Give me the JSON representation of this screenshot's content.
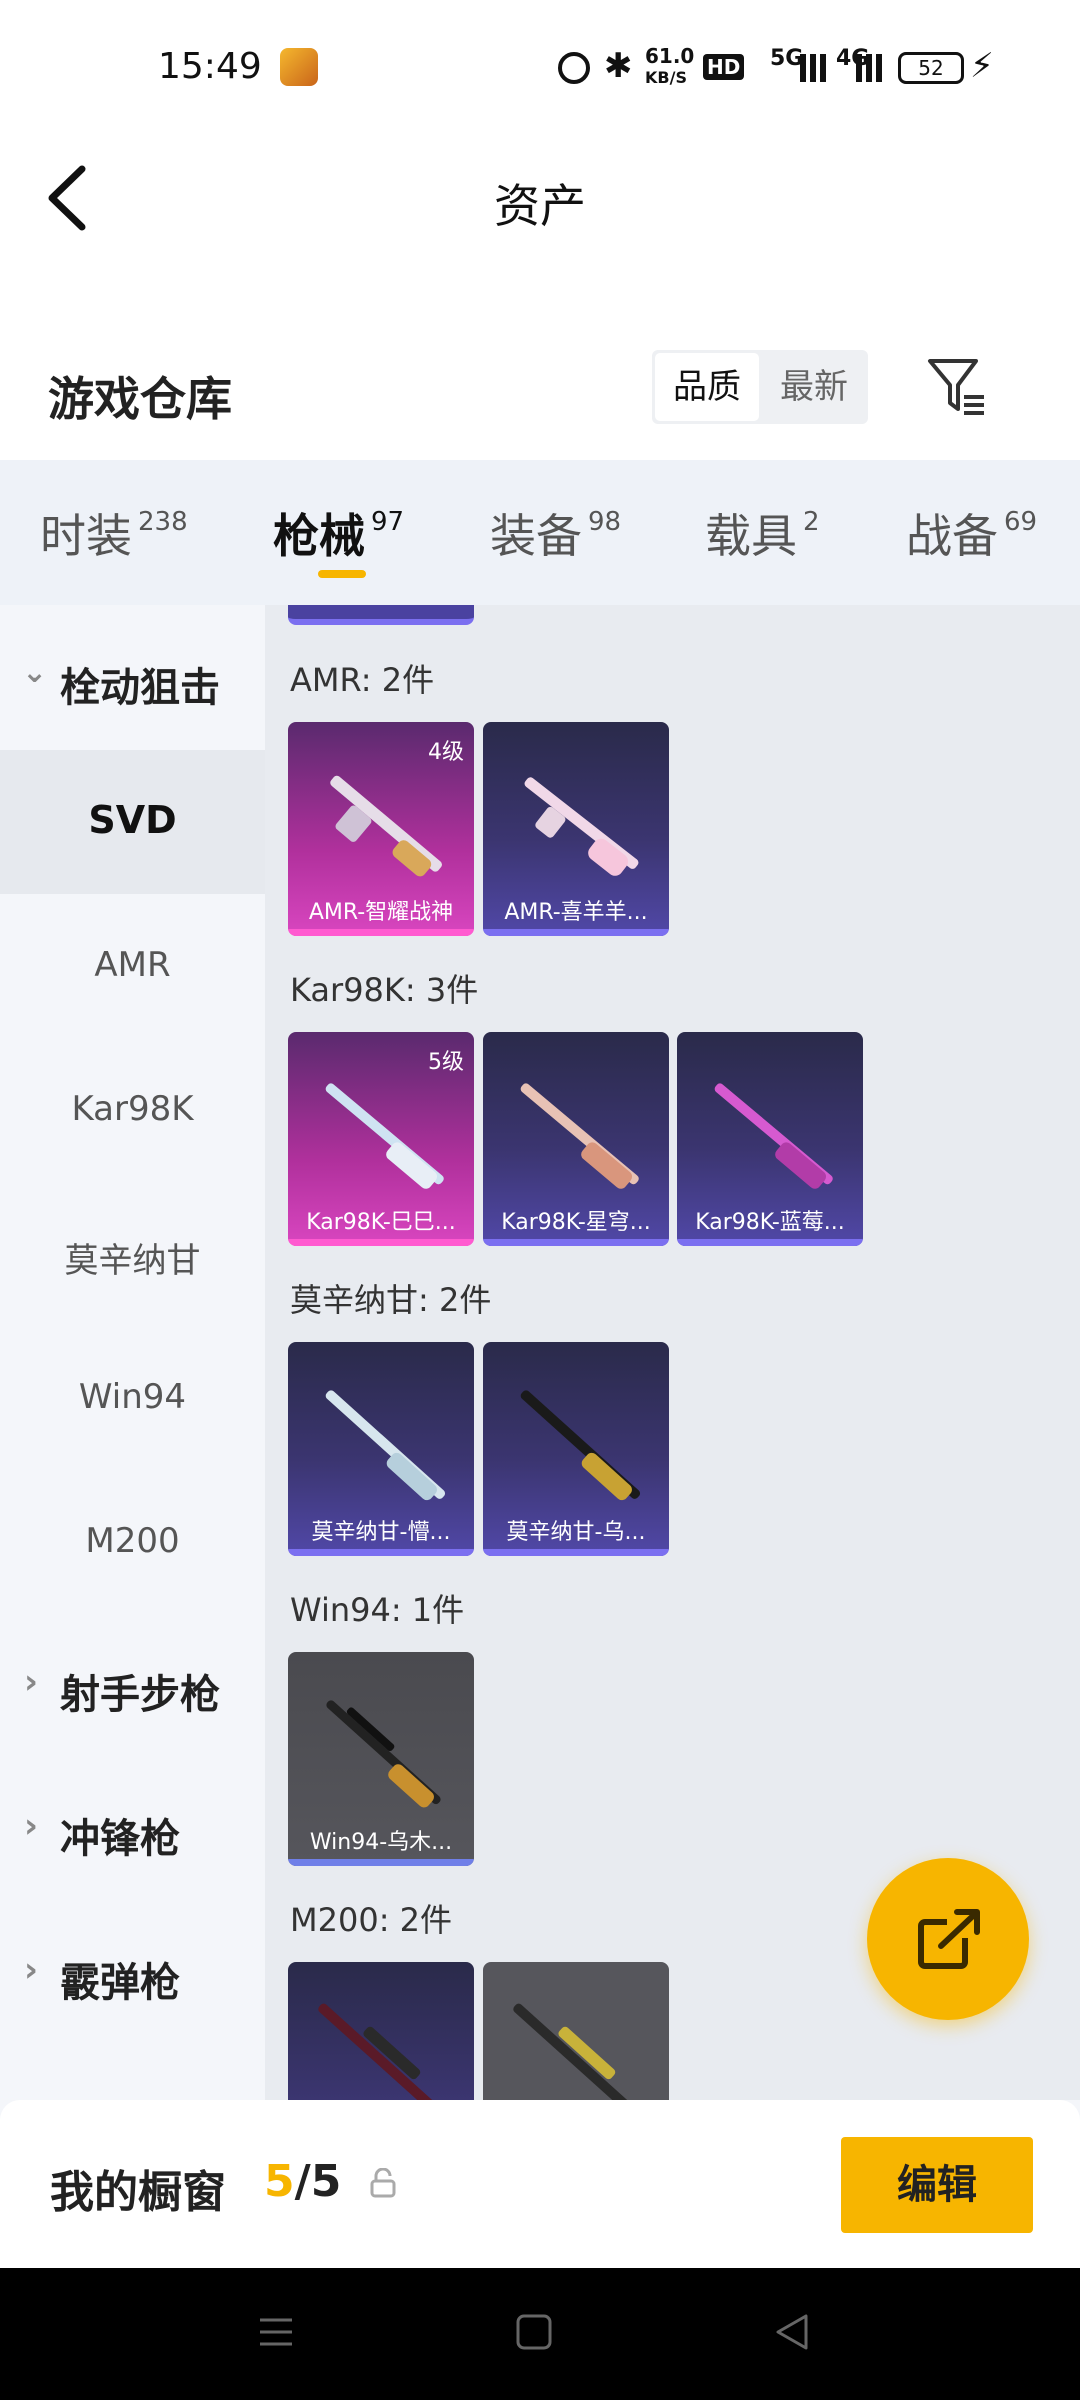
{
  "status": {
    "time": "15:49",
    "net_speed": "61.0",
    "net_unit": "KB/S",
    "hd": "HD",
    "sig1": "5G",
    "sig2": "4G",
    "battery": "52"
  },
  "header": {
    "title": "资产"
  },
  "warehouse": {
    "title": "游戏仓库",
    "sort_quality": "品质",
    "sort_latest": "最新"
  },
  "tabs": [
    {
      "label": "时装",
      "count": "238"
    },
    {
      "label": "枪械",
      "count": "97"
    },
    {
      "label": "装备",
      "count": "98"
    },
    {
      "label": "载具",
      "count": "2"
    },
    {
      "label": "战备",
      "count": "69"
    }
  ],
  "sidebar": {
    "group_open": "栓动狙击",
    "items": [
      "SVD",
      "AMR",
      "Kar98K",
      "莫辛纳甘",
      "Win94",
      "M200"
    ],
    "groups": [
      "射手步枪",
      "冲锋枪",
      "霰弹枪"
    ]
  },
  "groups": [
    {
      "title": "AMR: 2件",
      "cards": [
        {
          "name": "AMR-智耀战神",
          "level": "4级",
          "style": "pink"
        },
        {
          "name": "AMR-喜羊羊...",
          "style": "blue"
        }
      ]
    },
    {
      "title": "Kar98K: 3件",
      "cards": [
        {
          "name": "Kar98K-巳巳...",
          "level": "5级",
          "style": "pink"
        },
        {
          "name": "Kar98K-星穹...",
          "style": "blue"
        },
        {
          "name": "Kar98K-蓝莓...",
          "style": "blue"
        }
      ]
    },
    {
      "title": "莫辛纳甘: 2件",
      "cards": [
        {
          "name": "莫辛纳甘-懵...",
          "style": "blue"
        },
        {
          "name": "莫辛纳甘-乌...",
          "style": "blue"
        }
      ]
    },
    {
      "title": "Win94: 1件",
      "cards": [
        {
          "name": "Win94-乌木...",
          "style": "gray"
        }
      ]
    },
    {
      "title": "M200: 2件",
      "cards": [
        {
          "name": "",
          "style": "blue"
        },
        {
          "name": "",
          "style": "gray"
        }
      ]
    }
  ],
  "bottom": {
    "label": "我的橱窗",
    "count_current": "5",
    "count_sep": "/",
    "count_total": "5",
    "edit_label": "编辑"
  },
  "colors": {
    "accent": "#f7b500",
    "pink": "#d946c0",
    "blue": "#5148a8"
  }
}
